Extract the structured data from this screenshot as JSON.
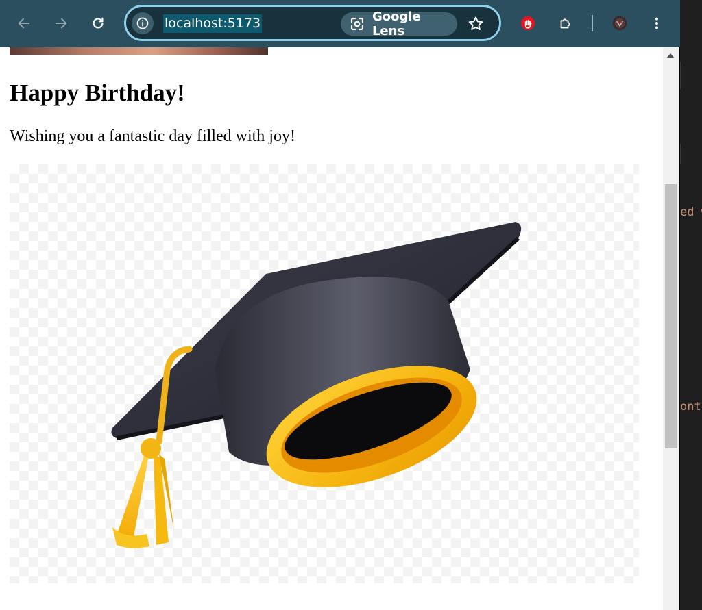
{
  "browser": {
    "url": "localhost:5173",
    "lens_label": "Google Lens",
    "icons": {
      "back": "arrow-left",
      "forward": "arrow-right",
      "reload": "reload",
      "site_info": "info-circle",
      "lens": "google-lens",
      "bookmark": "star-outline",
      "adblock": "stop-hand",
      "extensions": "puzzle-piece",
      "profile": "avatar",
      "menu": "vertical-dots"
    },
    "colors": {
      "toolbar": "#2b4f5e",
      "omnibox_border": "#8fd0ec",
      "adblock_red": "#e5141f"
    }
  },
  "page": {
    "heading": "Happy Birthday!",
    "message": "Wishing you a fantastic day filled with joy!",
    "image": "graduation-cap"
  },
  "editor": {
    "fragments": [
      "ed w",
      "ont"
    ]
  }
}
